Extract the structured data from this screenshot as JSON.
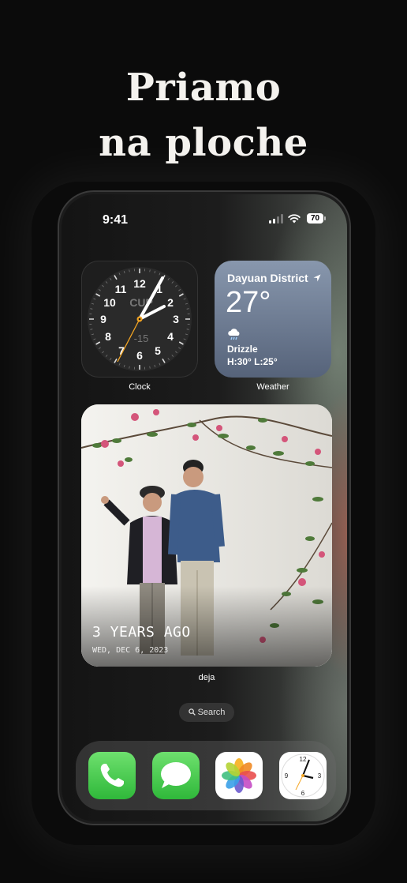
{
  "headline": {
    "line1": "Priamo",
    "line2": "na ploche"
  },
  "status_bar": {
    "time": "9:41",
    "battery": "70"
  },
  "widgets": {
    "clock": {
      "label": "Clock",
      "city": "CUP",
      "offset": "-15",
      "numbers": [
        "12",
        "1",
        "2",
        "3",
        "4",
        "5",
        "6",
        "7",
        "8",
        "9",
        "10",
        "11"
      ]
    },
    "weather": {
      "label": "Weather",
      "location": "Dayuan District",
      "temperature": "27°",
      "condition": "Drizzle",
      "high_low": "H:30° L:25°"
    },
    "photo": {
      "label": "deja",
      "title": "3 YEARS AGO",
      "date": "WED, DEC 6, 2023"
    }
  },
  "search": {
    "label": "Search"
  },
  "dock": {
    "apps": [
      "phone",
      "messages",
      "photos",
      "clock"
    ]
  },
  "colors": {
    "background": "#0b0b0b",
    "weather_top": "#8897ad",
    "weather_bottom": "#56637a"
  }
}
